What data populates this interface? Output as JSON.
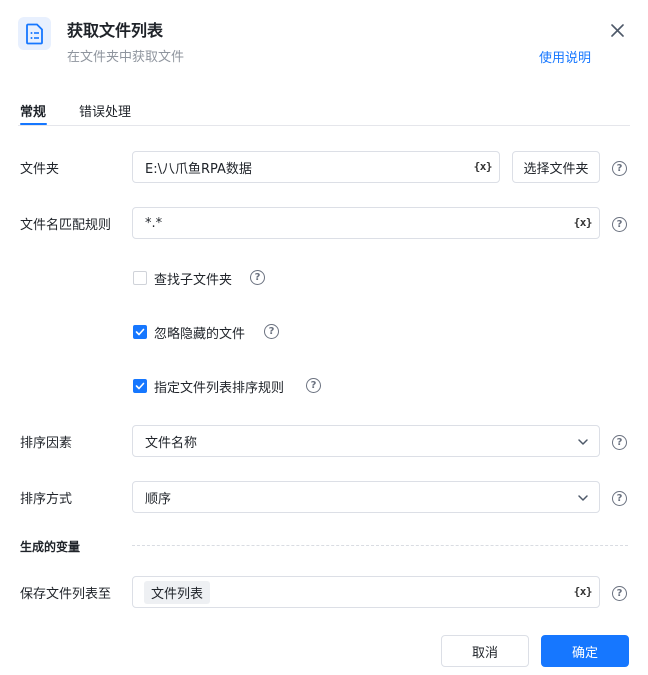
{
  "header": {
    "title": "获取文件列表",
    "subtitle": "在文件夹中获取文件",
    "help_link": "使用说明",
    "icon": "file-list-icon"
  },
  "tabs": [
    {
      "label": "常规",
      "active": true
    },
    {
      "label": "错误处理",
      "active": false
    }
  ],
  "form": {
    "folder": {
      "label": "文件夹",
      "value": "E:\\八爪鱼RPA数据",
      "choose_button": "选择文件夹"
    },
    "pattern": {
      "label": "文件名匹配规则",
      "value": "*.*"
    },
    "include_subfolders": {
      "label": "查找子文件夹",
      "checked": false
    },
    "ignore_hidden": {
      "label": "忽略隐藏的文件",
      "checked": true
    },
    "custom_sort": {
      "label": "指定文件列表排序规则",
      "checked": true
    },
    "sort_by": {
      "label": "排序因素",
      "value": "文件名称"
    },
    "sort_order": {
      "label": "排序方式",
      "value": "顺序"
    }
  },
  "output": {
    "section_title": "生成的变量",
    "save_label": "保存文件列表至",
    "variable": "文件列表"
  },
  "var_icon_text": "{x}",
  "help_icon_text": "?",
  "footer": {
    "cancel": "取消",
    "ok": "确定"
  },
  "colors": {
    "accent": "#1677ff",
    "muted": "#8f959e"
  }
}
